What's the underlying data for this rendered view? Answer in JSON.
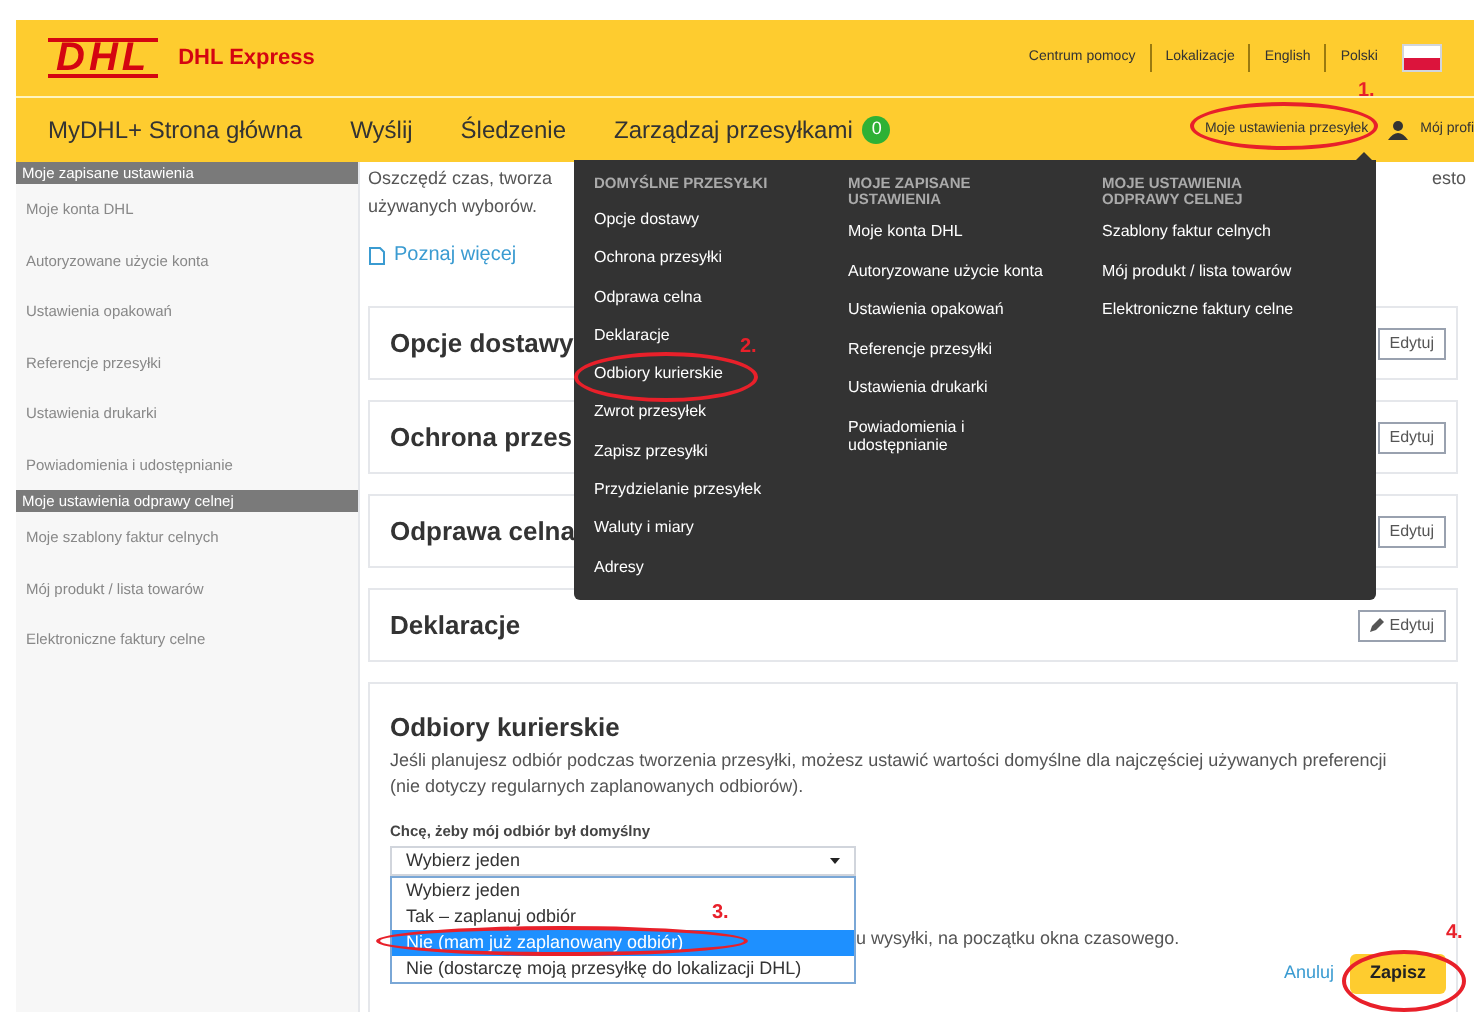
{
  "header": {
    "logo": "DHL",
    "brand": "DHL Express",
    "links": [
      {
        "label": "Centrum pomocy"
      },
      {
        "label": "Lokalizacje"
      },
      {
        "label": "English"
      },
      {
        "label": "Polski"
      }
    ]
  },
  "nav": {
    "items": [
      {
        "label": "MyDHL+ Strona główna"
      },
      {
        "label": "Wyślij"
      },
      {
        "label": "Śledzenie"
      },
      {
        "label": "Zarządzaj przesyłkami",
        "badge": "0"
      }
    ],
    "settings": {
      "label": "Moje ustawienia przesyłek",
      "open": true
    },
    "profile": "Mój profi"
  },
  "sidebar": {
    "sections": [
      {
        "title": "Moje zapisane ustawienia",
        "items": [
          "Moje konta DHL",
          "Autoryzowane użycie konta",
          "Ustawienia opakowań",
          "Referencje przesyłki",
          "Ustawienia drukarki",
          "Powiadomienia i udostępnianie"
        ]
      },
      {
        "title": "Moje ustawienia odprawy celnej",
        "items": [
          "Moje szablony faktur celnych",
          "Mój produkt / lista towarów",
          "Elektroniczne faktury celne"
        ]
      }
    ]
  },
  "intro": {
    "line_1": "Oszczędź czas, tworza",
    "line_1_end": "esto",
    "line_2": "używanych wyborów.",
    "link": "Poznaj więcej"
  },
  "cards": [
    {
      "title": "Opcje dostawy",
      "button": "Edytuj",
      "icon_visible": false
    },
    {
      "title": "Ochrona przes",
      "button": "Edytuj",
      "icon_visible": false
    },
    {
      "title": "Odprawa celna",
      "button": "Edytuj",
      "icon_visible": false
    },
    {
      "title": "Deklaracje",
      "button": "Edytuj",
      "icon_visible": true
    }
  ],
  "pickup": {
    "title": "Odbiory kurierskie",
    "description": "Jeśli planujesz odbiór podczas tworzenia przesyłki, możesz ustawić wartości domyślne dla najczęściej używanych preferencji (nie dotyczy regularnych zaplanowanych odbiorów).",
    "field_label": "Chcę, żeby mój odbiór był domyślny",
    "select_value": "Wybierz jeden",
    "options": [
      {
        "label": "Wybierz jeden",
        "selected": false
      },
      {
        "label": "Tak – zaplanuj odbiór",
        "selected": false
      },
      {
        "label": "Nie (mam już zaplanowany odbiór)",
        "selected": true
      },
      {
        "label": "Nie (dostarczę moją przesyłkę do lokalizacji DHL)",
        "selected": false
      }
    ],
    "hint": "u wysyłki, na początku okna czasowego.",
    "cancel": "Anuluj",
    "save": "Zapisz"
  },
  "menu": {
    "columns": [
      {
        "heading": "DOMYŚLNE PRZESYŁKI",
        "items": [
          "Opcje dostawy",
          "Ochrona przesyłki",
          "Odprawa celna",
          "Deklaracje",
          "Odbiory kurierskie",
          "Zwrot przesyłek",
          "Zapisz przesyłki",
          "Przydzielanie przesyłek",
          "Waluty i miary",
          "Adresy"
        ]
      },
      {
        "heading": "MOJE ZAPISANE USTAWIENIA",
        "items": [
          "Moje konta DHL",
          "Autoryzowane użycie konta",
          "Ustawienia opakowań",
          "Referencje przesyłki",
          "Ustawienia drukarki",
          "Powiadomienia i udostępnianie"
        ]
      },
      {
        "heading": "MOJE USTAWIENIA ODPRAWY CELNEJ",
        "items": [
          "Szablony faktur celnych",
          "Mój produkt / lista towarów",
          "Elektroniczne faktury celne"
        ]
      }
    ]
  },
  "annotations": [
    {
      "number": "1."
    },
    {
      "number": "2."
    },
    {
      "number": "3."
    },
    {
      "number": "4."
    }
  ]
}
